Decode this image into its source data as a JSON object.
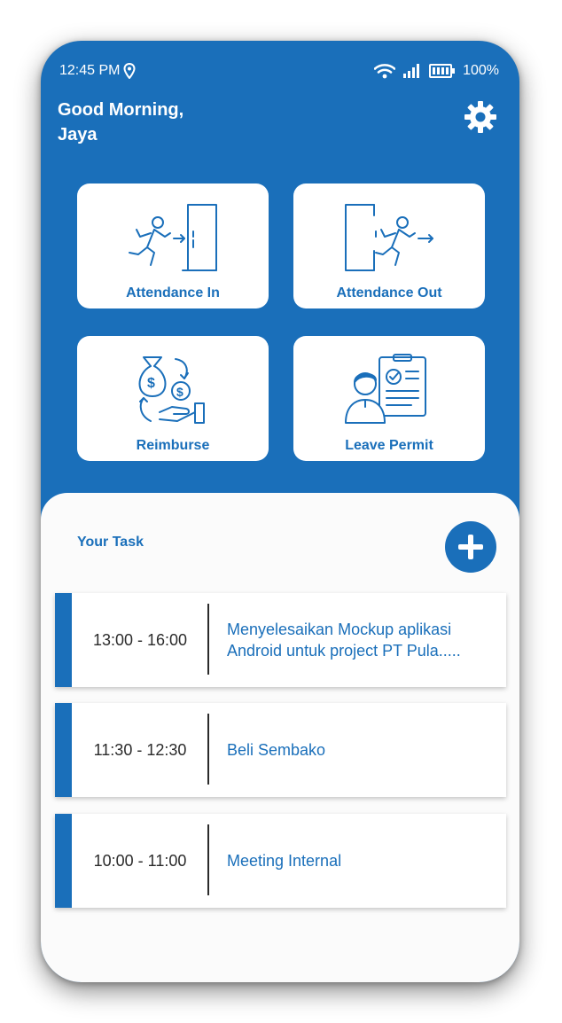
{
  "status_bar": {
    "time": "12:45 PM",
    "battery": "100%"
  },
  "header": {
    "greeting_line1": "Good Morning,",
    "greeting_line2": "Jaya"
  },
  "menu": {
    "attendance_in": "Attendance In",
    "attendance_out": "Attendance Out",
    "reimburse": "Reimburse",
    "leave_permit": "Leave Permit"
  },
  "tasks_section": {
    "title": "Your Task"
  },
  "tasks": [
    {
      "time": "13:00 - 16:00",
      "description": "Menyelesaikan Mockup aplikasi Android untuk project PT Pula....."
    },
    {
      "time": "11:30 - 12:30",
      "description": "Beli Sembako"
    },
    {
      "time": "10:00 - 11:00",
      "description": "Meeting Internal"
    }
  ],
  "colors": {
    "primary": "#1a6fba",
    "card": "#ffffff",
    "sheet": "#fbfbfb"
  }
}
